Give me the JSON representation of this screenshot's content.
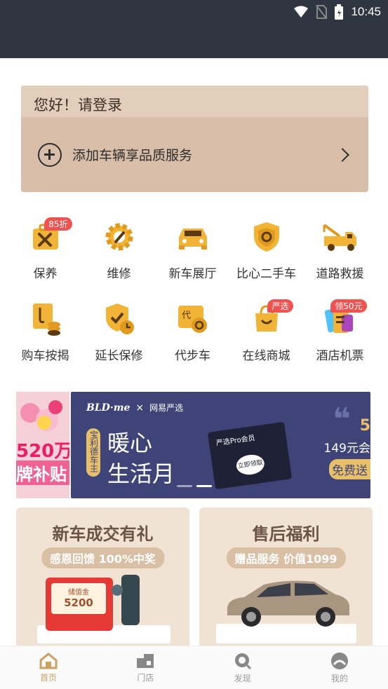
{
  "status": {
    "time": "10:45"
  },
  "login": {
    "greeting": "您好！请登录",
    "add_vehicle": "添加车辆享品质服务"
  },
  "services": [
    {
      "label": "保养",
      "badge": "85折",
      "icon": "maintenance-tools-icon"
    },
    {
      "label": "维修",
      "badge": "",
      "icon": "repair-gear-icon"
    },
    {
      "label": "新车展厅",
      "badge": "",
      "icon": "new-car-icon"
    },
    {
      "label": "比心二手车",
      "badge": "",
      "icon": "used-car-shield-icon"
    },
    {
      "label": "道路救援",
      "badge": "",
      "icon": "tow-truck-icon"
    },
    {
      "label": "购车按揭",
      "badge": "",
      "icon": "loan-coins-icon"
    },
    {
      "label": "延长保修",
      "badge": "",
      "icon": "warranty-shield-icon"
    },
    {
      "label": "代步车",
      "badge": "",
      "icon": "substitute-car-icon"
    },
    {
      "label": "在线商城",
      "badge": "严选",
      "icon": "shopping-bag-icon"
    },
    {
      "label": "酒店机票",
      "badge": "领50元",
      "icon": "hotel-ticket-icon"
    }
  ],
  "banner": {
    "left_text1": "520万",
    "left_text2": "牌补贴",
    "brand": "BLD·me",
    "partner": "网易严选",
    "vertical_tag": "宝利德车主",
    "headline1": "暖心",
    "headline2": "生活月",
    "card_label": "严选Pro会员",
    "card_button": "立即领取",
    "price": "149元会",
    "free": "免费送",
    "number": "5"
  },
  "promos": [
    {
      "title": "新车成交有礼",
      "subtitle": "感恩回馈 100%中奖",
      "card_label": "储值金",
      "card_value": "5200"
    },
    {
      "title": "售后福利",
      "subtitle": "赠品服务 价值1099"
    }
  ],
  "tabs": [
    {
      "label": "首页",
      "icon": "home-icon",
      "active": true
    },
    {
      "label": "门店",
      "icon": "store-icon",
      "active": false
    },
    {
      "label": "发现",
      "icon": "discover-icon",
      "active": false
    },
    {
      "label": "我的",
      "icon": "profile-icon",
      "active": false
    }
  ],
  "colors": {
    "accent": "#c9a165",
    "icon_yellow": "#f2b437",
    "status_bar": "#2f3541",
    "card": "#d8bea8"
  }
}
